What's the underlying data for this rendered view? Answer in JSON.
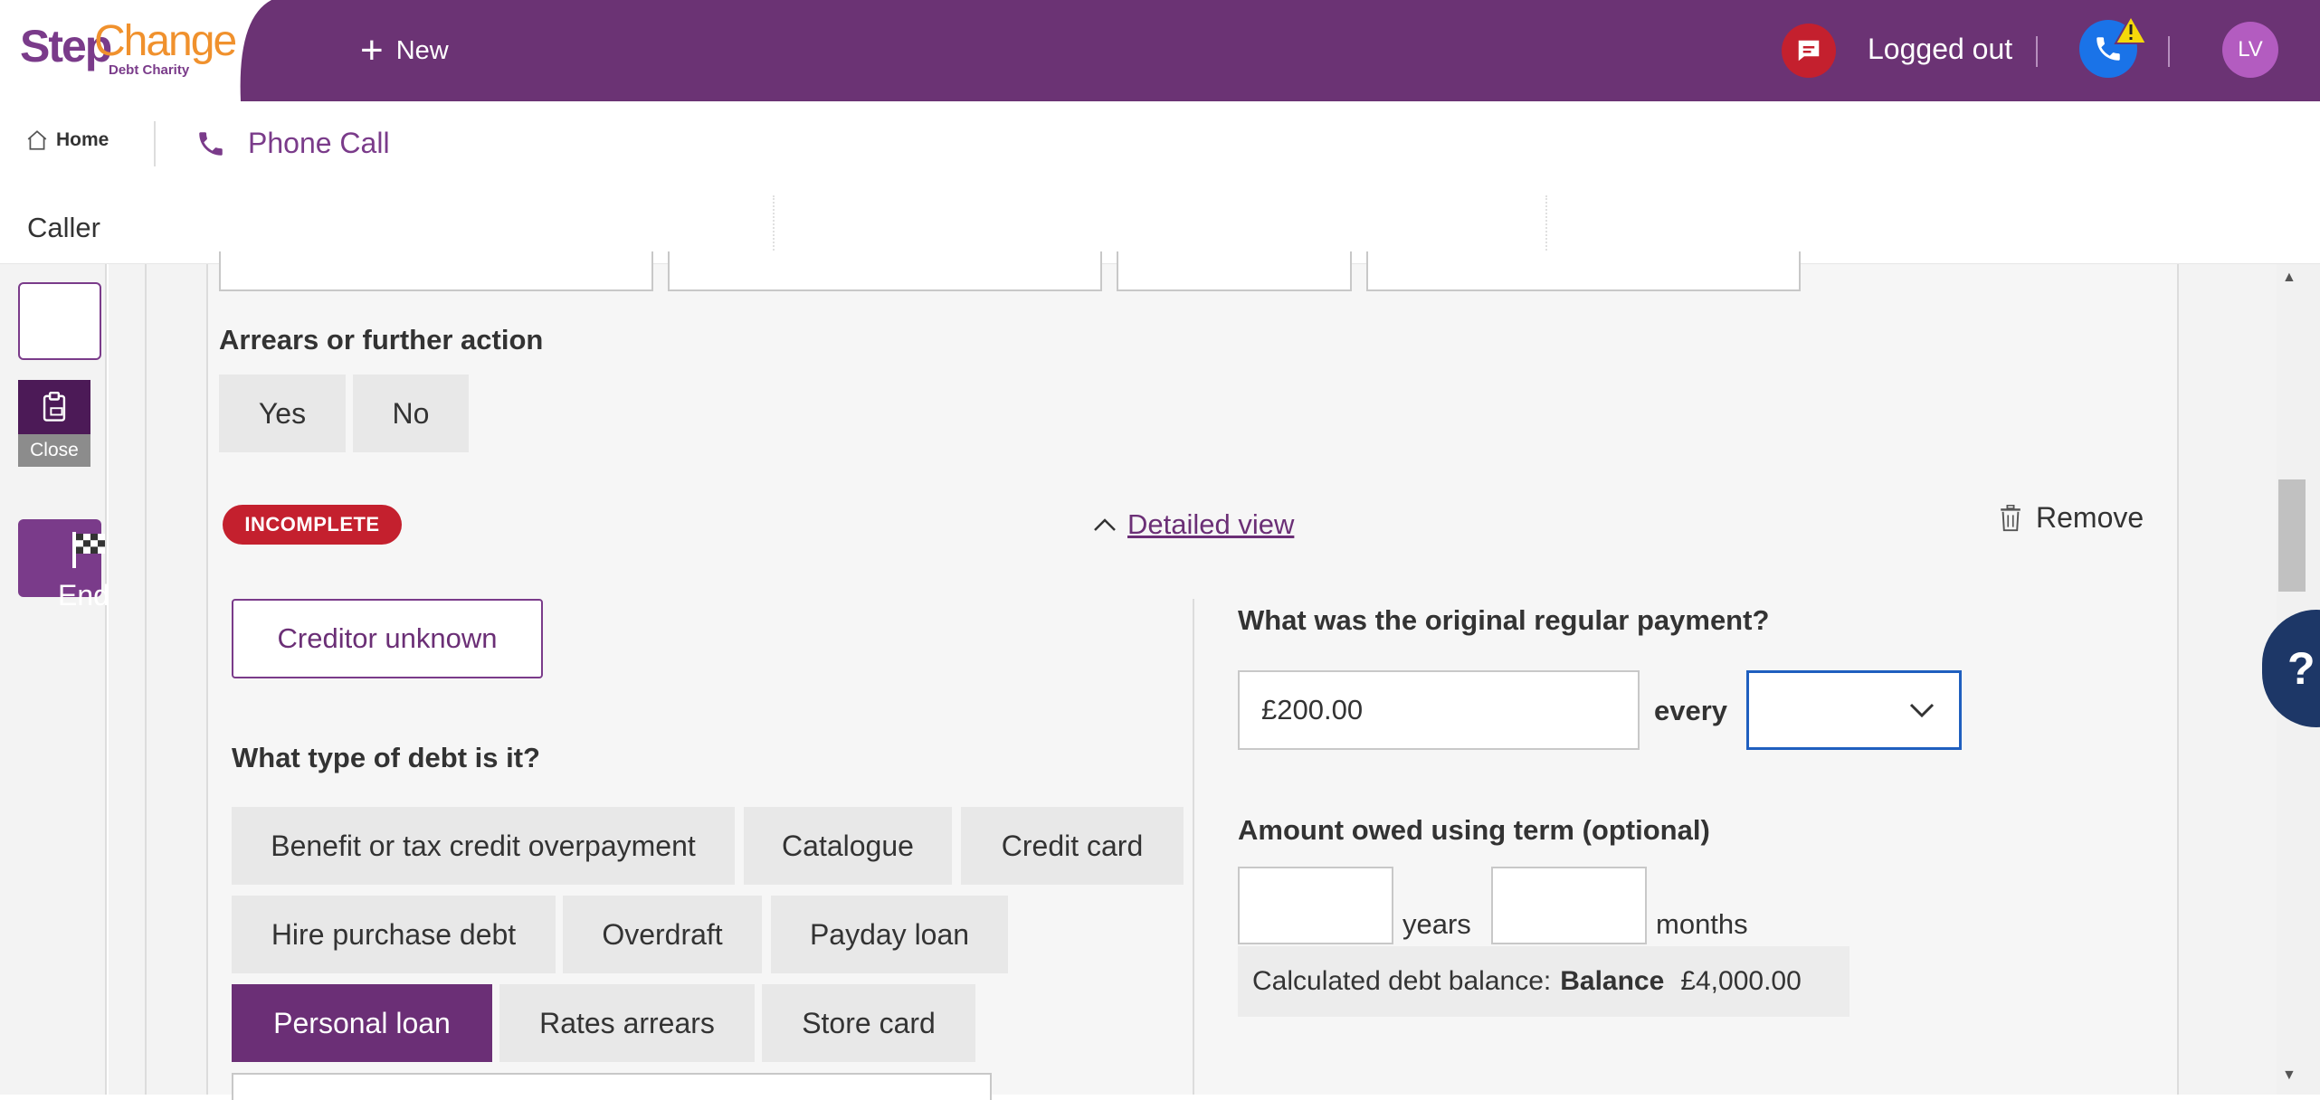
{
  "header": {
    "logo_step": "Step",
    "logo_change": "Change",
    "logo_sub": "Debt Charity",
    "new_label": "New",
    "status": "Logged out",
    "avatar_initials": "LV"
  },
  "tabs": {
    "home": "Home",
    "phone_call": "Phone Call"
  },
  "caller": {
    "label": "Caller"
  },
  "rail": {
    "close_label": "Close",
    "end_session_label": "End Session"
  },
  "arrears": {
    "label": "Arrears or further action",
    "yes": "Yes",
    "no": "No"
  },
  "status_badge": "INCOMPLETE",
  "detailed_view": "Detailed view",
  "remove": "Remove",
  "creditor_unknown": "Creditor unknown",
  "debt_type": {
    "label": "What type of debt is it?",
    "options": [
      "Benefit or tax credit overpayment",
      "Catalogue",
      "Credit card",
      "Hire purchase debt",
      "Overdraft",
      "Payday loan",
      "Personal loan",
      "Rates arrears",
      "Store card"
    ],
    "selected": "Personal loan"
  },
  "payment": {
    "label": "What was the original regular payment?",
    "amount": "£200.00",
    "every": "every",
    "frequency": ""
  },
  "term": {
    "label": "Amount owed using term (optional)",
    "years_value": "",
    "years_label": "years",
    "months_value": "",
    "months_label": "months"
  },
  "calc": {
    "prefix": "Calculated debt balance:",
    "balance_label": "Balance",
    "amount": "£4,000.00"
  },
  "help": "?",
  "colors": {
    "brand_purple": "#6b3374",
    "selected_purple": "#6b2f76",
    "badge_red": "#c4202e",
    "logo_orange": "#f0912d",
    "focus_blue": "#1f5fbf",
    "help_navy": "#1d3767"
  }
}
